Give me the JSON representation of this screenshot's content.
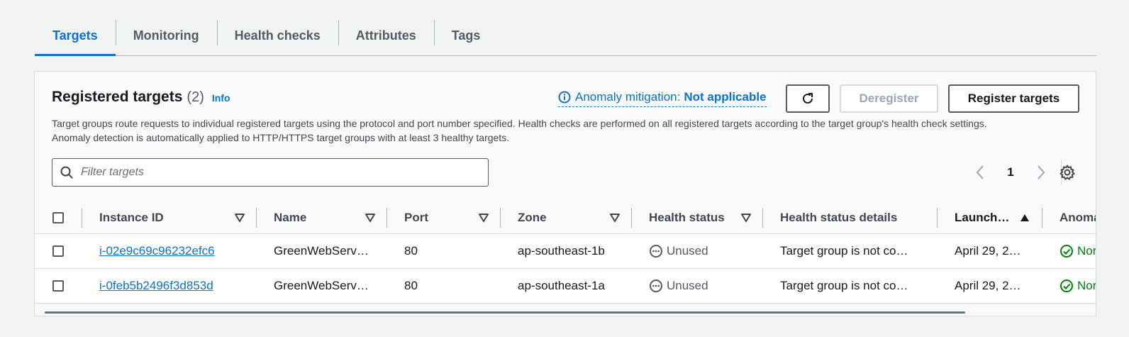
{
  "tabs": [
    "Targets",
    "Monitoring",
    "Health checks",
    "Attributes",
    "Tags"
  ],
  "panel": {
    "title": "Registered targets",
    "count": "(2)",
    "info": "Info",
    "description_line1": "Target groups route requests to individual registered targets using the protocol and port number specified. Health checks are performed on all registered targets according to the target group's health check settings.",
    "description_line2": "Anomaly detection is automatically applied to HTTP/HTTPS target groups with at least 3 healthy targets.",
    "anomaly_label": "Anomaly mitigation:",
    "anomaly_value": "Not applicable",
    "deregister_label": "Deregister",
    "register_label": "Register targets"
  },
  "search": {
    "placeholder": "Filter targets"
  },
  "pagination": {
    "current_page": "1"
  },
  "table": {
    "columns": [
      "Instance ID",
      "Name",
      "Port",
      "Zone",
      "Health status",
      "Health status details",
      "Launch…",
      "Anoma"
    ],
    "rows": [
      {
        "instance_id": "i-02e9c69c96232efc6",
        "name": "GreenWebServ…",
        "port": "80",
        "zone": "ap-southeast-1b",
        "health_status": "Unused",
        "health_details": "Target group is not co…",
        "launch": "April 29, 2…",
        "anomaly": "Nor"
      },
      {
        "instance_id": "i-0feb5b2496f3d853d",
        "name": "GreenWebServ…",
        "port": "80",
        "zone": "ap-southeast-1a",
        "health_status": "Unused",
        "health_details": "Target group is not co…",
        "launch": "April 29, 2…",
        "anomaly": "Nor"
      }
    ]
  },
  "colors": {
    "link": "#0972d3",
    "success": "#037f0c",
    "text": "#16191f",
    "muted": "#545b64"
  },
  "icons": [
    "info-icon",
    "refresh-icon",
    "search-icon",
    "chevron-left-icon",
    "chevron-right-icon",
    "gear-icon",
    "filter-icon",
    "sort-ascending-icon",
    "unused-status-icon",
    "check-circle-icon"
  ]
}
